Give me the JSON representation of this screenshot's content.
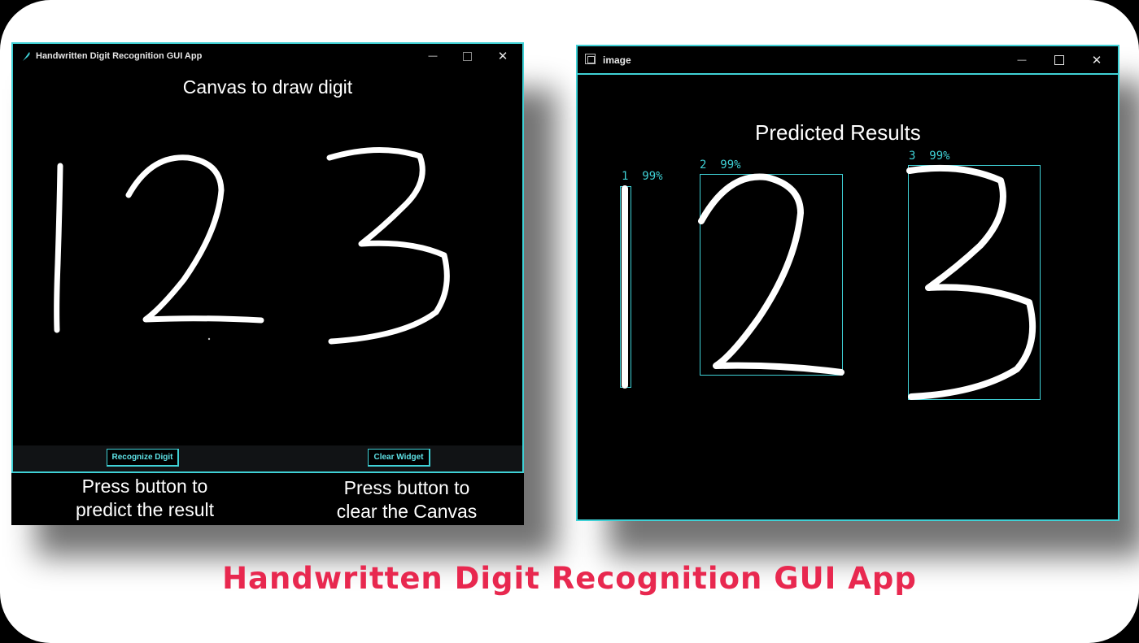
{
  "left_window": {
    "title": "Handwritten Digit Recognition GUI App",
    "icon": "feather-icon",
    "canvas_heading": "Canvas to draw digit",
    "buttons": {
      "recognize": "Recognize Digit",
      "clear": "Clear Widget"
    }
  },
  "notes": {
    "recognize_line1": "Press button to",
    "recognize_line2": "predict the result",
    "clear_line1": "Press button to",
    "clear_line2": "clear the Canvas"
  },
  "right_window": {
    "title": "image",
    "icon": "image-window-icon",
    "heading": "Predicted Results",
    "predictions": [
      {
        "digit": "1",
        "confidence": "99%"
      },
      {
        "digit": "2",
        "confidence": "99%"
      },
      {
        "digit": "3",
        "confidence": "99%"
      }
    ]
  },
  "window_controls": {
    "minimize": "—",
    "maximize": "☐",
    "close": "✕"
  },
  "caption": "Handwritten Digit Recognition GUI App",
  "colors": {
    "accent": "#3fd1d6",
    "caption": "#e8284f",
    "background": "#000000"
  }
}
